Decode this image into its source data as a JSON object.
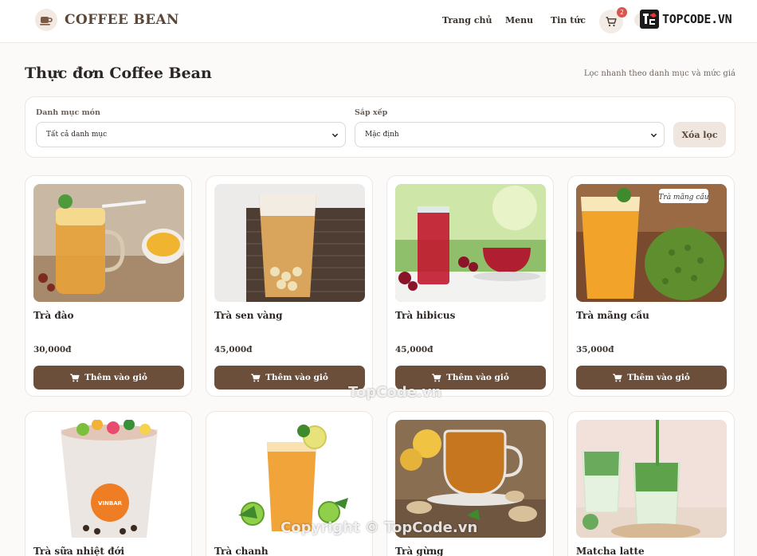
{
  "header": {
    "brand": "COFFEE BEAN",
    "nav": [
      "Trang chủ",
      "Menu",
      "Tin tức"
    ],
    "cart_count": "2",
    "watermark_logo": "TOPCODE.VN"
  },
  "page": {
    "title": "Thực đơn Coffee Bean",
    "hint": "Lọc nhanh theo danh mục và mức giá"
  },
  "filters": {
    "category_label": "Danh mục món",
    "category_value": "Tất cả danh mục",
    "sort_label": "Sắp xếp",
    "sort_value": "Mặc định",
    "clear_label": "Xóa lọc"
  },
  "add_label": "Thêm vào giỏ",
  "products": [
    {
      "name": "Trà đào",
      "price": "30,000đ"
    },
    {
      "name": "Trà sen vàng",
      "price": "45,000đ"
    },
    {
      "name": "Trà hibicus",
      "price": "45,000đ"
    },
    {
      "name": "Trà mãng cầu",
      "price": "35,000đ",
      "tag": "Trà mãng cầu"
    },
    {
      "name": "Trà sữa nhiệt đới",
      "price": "",
      "tag": "VINBAR"
    },
    {
      "name": "Trà chanh",
      "price": ""
    },
    {
      "name": "Trà gừng",
      "price": ""
    },
    {
      "name": "Matcha latte",
      "price": ""
    }
  ],
  "watermarks": {
    "center": "TopCode.vn",
    "bottom": "Copyright © TopCode.vn"
  },
  "colors": {
    "accent": "#6b4f3b",
    "brand": "#5c4637",
    "badge": "#d9534f"
  }
}
